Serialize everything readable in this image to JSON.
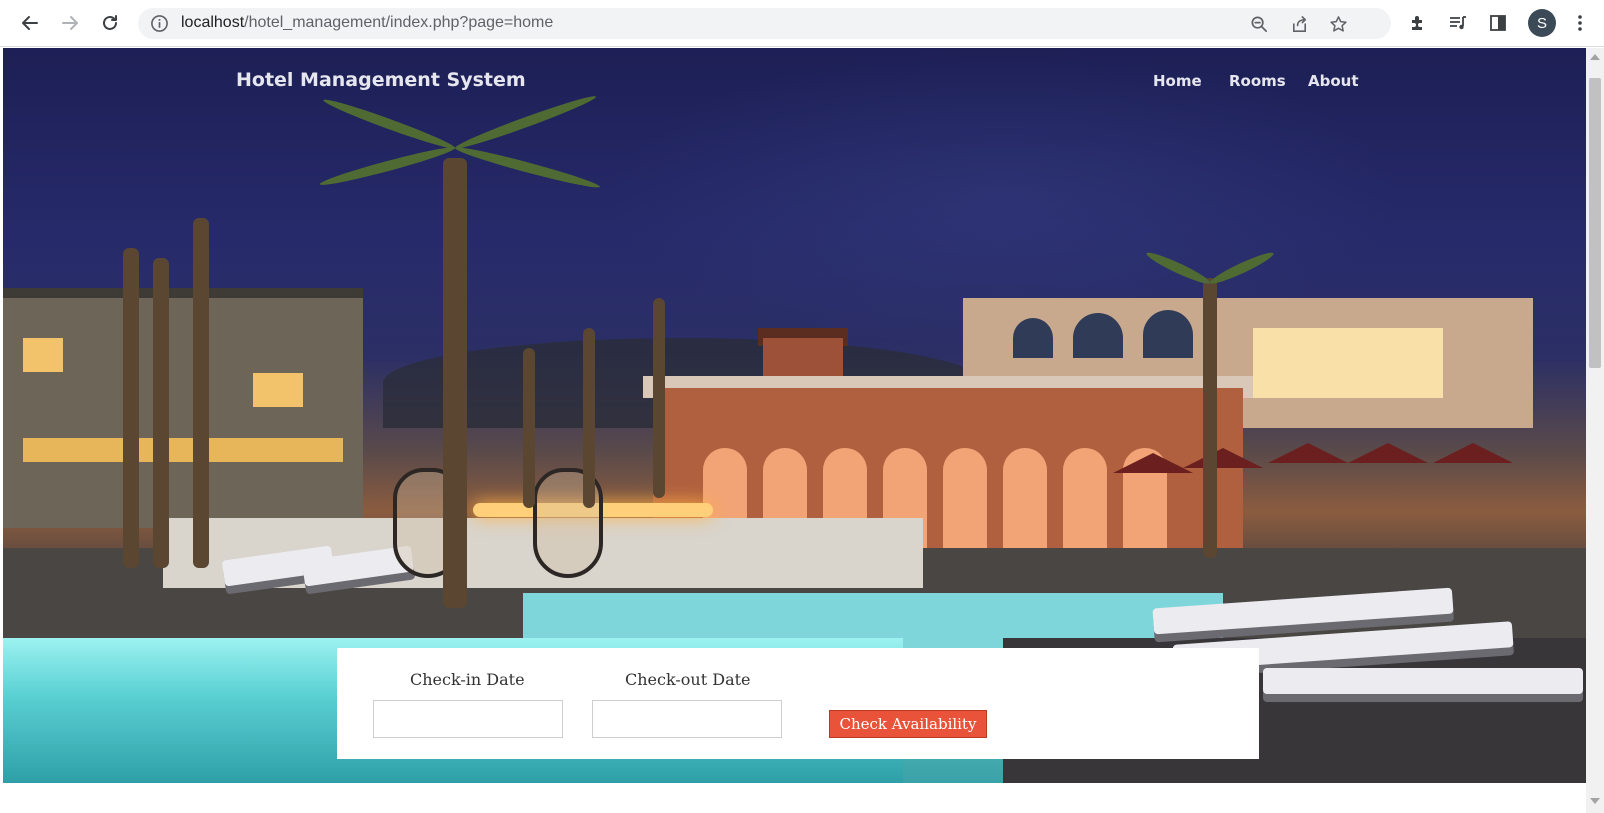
{
  "browser": {
    "url_domain": "localhost",
    "url_path": "/hotel_management/index.php?page=home",
    "profile_initial": "S",
    "icons": [
      "back-icon",
      "forward-icon",
      "reload-icon",
      "info-icon",
      "zoom-icon",
      "share-icon",
      "star-icon",
      "extensions-icon",
      "media-icon",
      "side-panel-icon",
      "menu-icon"
    ]
  },
  "site": {
    "brand": "Hotel Management System",
    "nav": [
      "Home",
      "Rooms",
      "About"
    ]
  },
  "booking": {
    "checkin_label": "Check-in Date",
    "checkout_label": "Check-out Date",
    "checkin_value": "",
    "checkout_value": "",
    "button_label": "Check Availability"
  },
  "colors": {
    "button": "#e8533a",
    "nav_text": "#e6e6ee",
    "sky": "#1d1f55"
  }
}
